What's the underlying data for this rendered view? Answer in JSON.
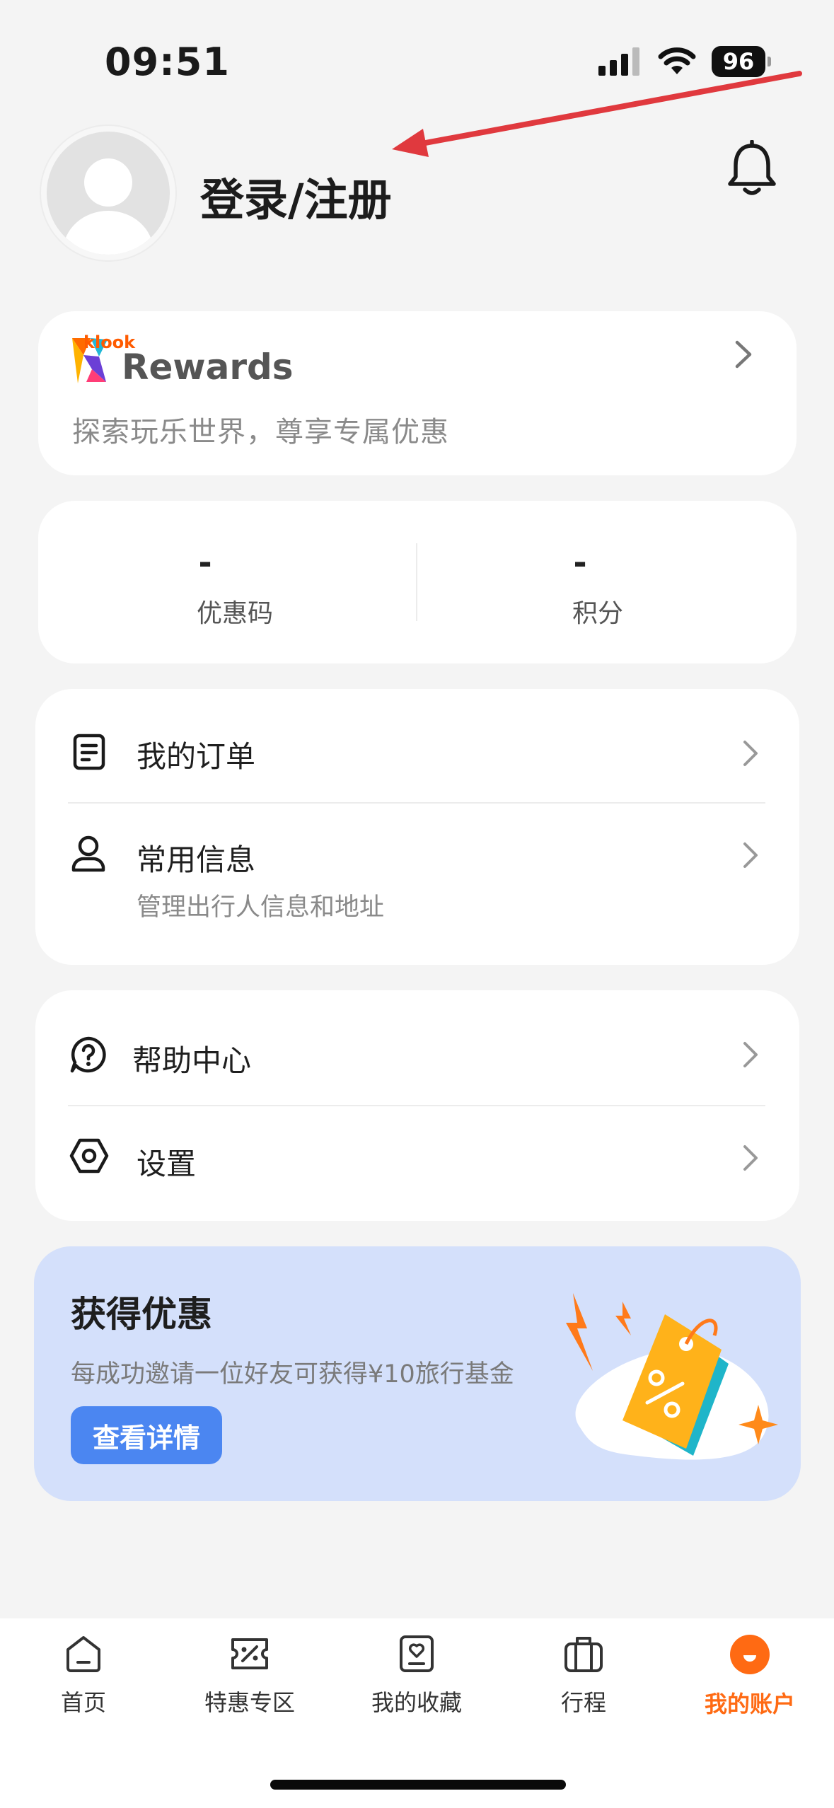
{
  "status_bar": {
    "time": "09:51",
    "battery": "96"
  },
  "header": {
    "login_label": "登录/注册"
  },
  "rewards": {
    "brand_small": "klook",
    "brand_large": "Rewards",
    "subtitle": "探索玩乐世界，尊享专属优惠"
  },
  "stats": [
    {
      "value": "-",
      "label": "优惠码"
    },
    {
      "value": "-",
      "label": "积分"
    }
  ],
  "menu_group1": [
    {
      "label": "我的订单",
      "icon": "order-icon"
    },
    {
      "label": "常用信息",
      "sub": "管理出行人信息和地址",
      "icon": "person-icon"
    }
  ],
  "menu_group2": [
    {
      "label": "帮助中心",
      "icon": "help-icon"
    },
    {
      "label": "设置",
      "icon": "settings-icon"
    }
  ],
  "promo": {
    "title": "获得优惠",
    "description": "每成功邀请一位好友可获得¥10旅行基金",
    "button": "查看详情"
  },
  "tabs": [
    {
      "label": "首页",
      "icon": "home-icon",
      "active": false
    },
    {
      "label": "特惠专区",
      "icon": "deals-icon",
      "active": false
    },
    {
      "label": "我的收藏",
      "icon": "favorites-icon",
      "active": false
    },
    {
      "label": "行程",
      "icon": "trips-icon",
      "active": false
    },
    {
      "label": "我的账户",
      "icon": "account-icon",
      "active": true
    }
  ],
  "colors": {
    "accent": "#ff6a13",
    "promo_bg": "#d4e0fb",
    "button_blue": "#4b86f1",
    "annotation_red": "#e0393e"
  }
}
